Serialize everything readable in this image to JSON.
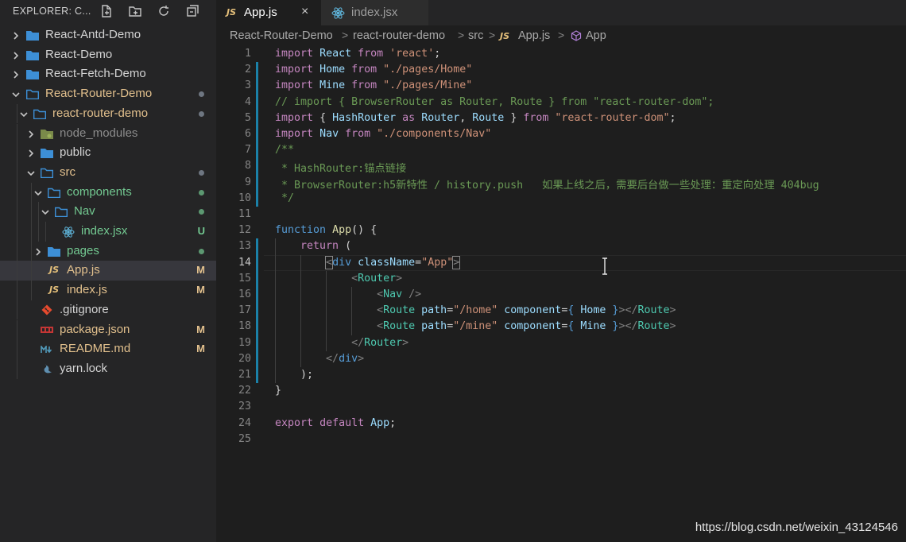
{
  "sidebar": {
    "title": "EXPLORER: C...",
    "items": [
      {
        "label": "React-Antd-Demo"
      },
      {
        "label": "React-Demo"
      },
      {
        "label": "React-Fetch-Demo"
      },
      {
        "label": "React-Router-Demo"
      },
      {
        "label": "react-router-demo"
      },
      {
        "label": "node_modules"
      },
      {
        "label": "public"
      },
      {
        "label": "src"
      },
      {
        "label": "components"
      },
      {
        "label": "Nav"
      },
      {
        "label": "index.jsx",
        "badge": "U"
      },
      {
        "label": "pages"
      },
      {
        "label": "App.js",
        "badge": "M"
      },
      {
        "label": "index.js",
        "badge": "M"
      },
      {
        "label": ".gitignore"
      },
      {
        "label": "package.json",
        "badge": "M"
      },
      {
        "label": "README.md",
        "badge": "M"
      },
      {
        "label": "yarn.lock"
      }
    ]
  },
  "tabs": [
    {
      "icon": "JS",
      "label": "App.js",
      "close": "×"
    },
    {
      "label": "index.jsx"
    }
  ],
  "breadcrumb": {
    "items": [
      "React-Router-Demo",
      "react-router-demo",
      "src",
      "App.js",
      "App"
    ],
    "separator": ">",
    "js_icon": "JS"
  },
  "editor": {
    "current_line": 14,
    "line_numbers": [
      "1",
      "2",
      "3",
      "4",
      "5",
      "6",
      "7",
      "8",
      "9",
      "10",
      "11",
      "12",
      "13",
      "14",
      "15",
      "16",
      "17",
      "18",
      "19",
      "20",
      "21",
      "22",
      "23",
      "24",
      "25"
    ]
  },
  "colors": {
    "keyword": "#c586c0",
    "keyword_blue": "#569cd6",
    "string": "#ce9178",
    "comment": "#6a9955",
    "function": "#dcdcaa",
    "component": "#4ec9b0",
    "git_modified_bar": "#1b81a8"
  },
  "watermark": "https://blog.csdn.net/weixin_43124546"
}
